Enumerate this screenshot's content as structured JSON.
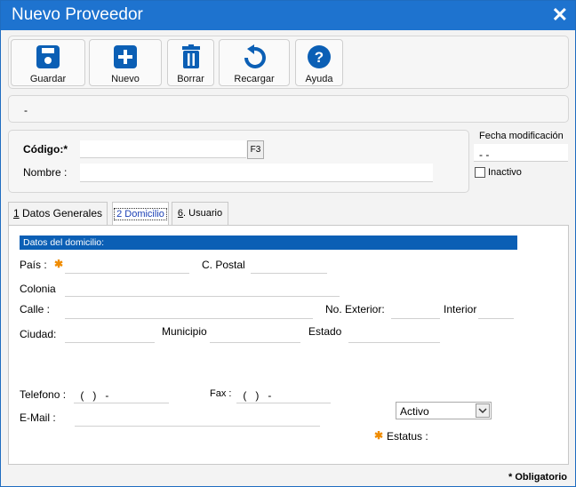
{
  "window": {
    "title": "Nuevo Proveedor",
    "close_icon": "✕"
  },
  "toolbar": {
    "guardar": "Guardar",
    "nuevo": "Nuevo",
    "borrar": "Borrar",
    "recargar": "Recargar",
    "ayuda": "Ayuda"
  },
  "info": {
    "text": "-"
  },
  "header_form": {
    "codigo_label": "Código:*",
    "codigo_value": "",
    "f3": "F3",
    "nombre_label": "Nombre :",
    "nombre_value": "",
    "fecha_label": "Fecha modificación",
    "fecha_value": "- -",
    "inactivo_label": "Inactivo"
  },
  "tabs": [
    {
      "num": "1",
      "label": " Datos Generales"
    },
    {
      "label": "2 Domicilio"
    },
    {
      "num": "6",
      "label": ". Usuario"
    }
  ],
  "domicilio": {
    "section_title": "Datos del domicilio:",
    "pais_label": "País :",
    "pais_value": "",
    "cpostal_label": "C. Postal",
    "colonia_label": "Colonia",
    "calle_label": "Calle :",
    "noext_label": "No. Exterior:",
    "interior_label": "Interior",
    "ciudad_label": "Ciudad:",
    "municipio_label": "Municipio",
    "estado_label": "Estado",
    "telefono_label": "Telefono :",
    "telefono_value": " (   )   -",
    "fax_label": "Fax :",
    "fax_value": " (   )   -",
    "email_label": "E-Mail :",
    "estatus_label": "Estatus :",
    "estatus_value": "Activo"
  },
  "footer": {
    "obligatorio": "* Obligatorio"
  },
  "colors": {
    "titlebar": "#1e73cf",
    "icon": "#0b5fb5",
    "section": "#0b5fb5",
    "required": "#f08c00"
  }
}
